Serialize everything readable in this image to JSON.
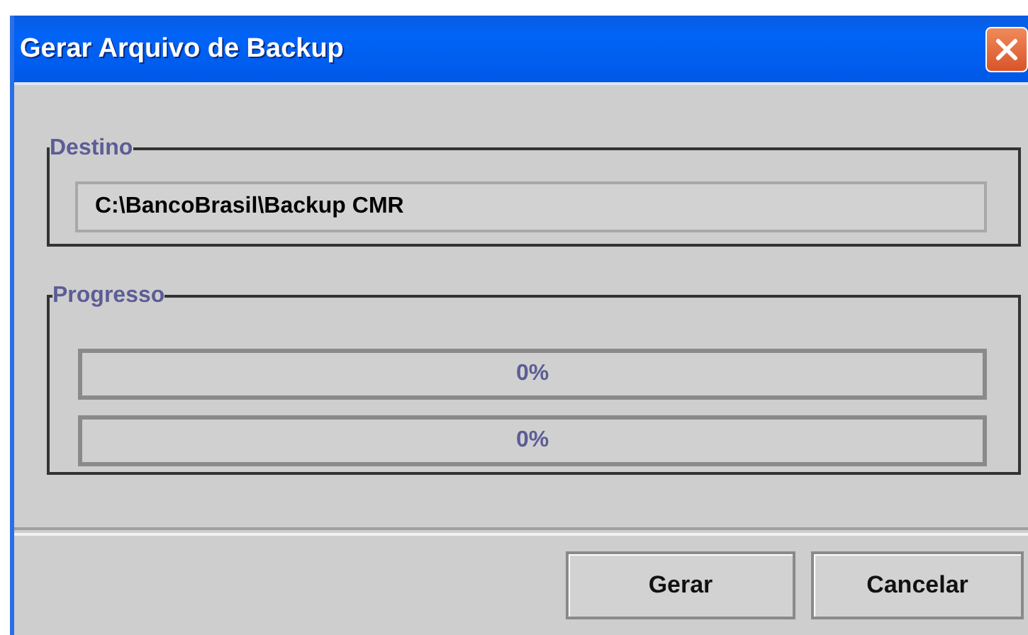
{
  "window": {
    "title": "Gerar Arquivo de Backup"
  },
  "destination": {
    "label": "Destino",
    "value": "C:\\BancoBrasil\\Backup CMR"
  },
  "progress": {
    "label": "Progresso",
    "bars": [
      {
        "level": 0,
        "reading": "0%"
      },
      {
        "level": 0,
        "reading": "0%"
      }
    ]
  },
  "buttons": [
    "Gerar",
    "Cancelar"
  ]
}
